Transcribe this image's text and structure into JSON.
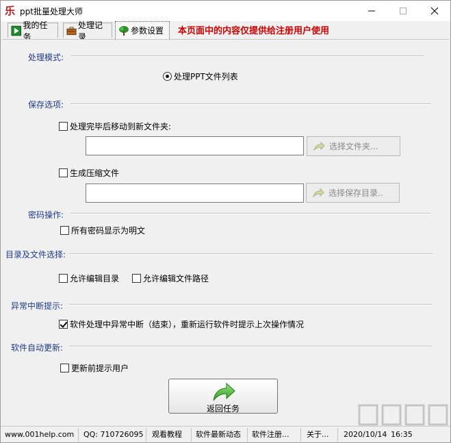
{
  "window": {
    "title": "ppt批量处理大师",
    "icon": "le-logo-icon"
  },
  "tabs": [
    {
      "label": "我的任务",
      "icon": "play-icon",
      "active": false
    },
    {
      "label": "处理记录",
      "icon": "briefcase-icon",
      "active": false
    },
    {
      "label": "参数设置",
      "icon": "tree-icon",
      "active": true
    }
  ],
  "notice": "本页面中的内容仅提供给注册用户使用",
  "sections": {
    "mode": {
      "title": "处理模式:",
      "radio_label": "处理PPT文件列表",
      "radio_selected": true
    },
    "save": {
      "title": "保存选项:",
      "move_label": "处理完毕后移动到新文件夹:",
      "move_checked": false,
      "folder_value": "",
      "choose_folder_label": "选择文件夹...",
      "zip_label": "生成压缩文件",
      "zip_checked": false,
      "zip_value": "",
      "choose_dir_label": "选择保存目录.."
    },
    "password": {
      "title": "密码操作:",
      "plain_label": "所有密码显示为明文",
      "plain_checked": false
    },
    "directory": {
      "title": "目录及文件选择:",
      "edit_dir_label": "允许编辑目录",
      "edit_dir_checked": false,
      "edit_path_label": "允许编辑文件路径",
      "edit_path_checked": false
    },
    "interrupt": {
      "title": "异常中断提示:",
      "prompt_label": "软件处理中异常中断（结束），重新运行软件时提示上次操作情况",
      "prompt_checked": true
    },
    "update": {
      "title": "软件自动更新:",
      "notify_label": "更新前提示用户",
      "notify_checked": false
    }
  },
  "return_button": {
    "label": "返回任务",
    "icon": "return-arrow-icon"
  },
  "statusbar": {
    "website": "www.001help.com",
    "qq": "QQ:  710726095",
    "tutorial": "观看教程",
    "news": "软件最新动态",
    "register": "软件注册...",
    "about": "关于...",
    "date": "2020/10/14",
    "time": "16:35"
  },
  "colors": {
    "notice": "#d00000",
    "section_title": "#1f3a8a",
    "panel_bg": "#f0f0f0"
  }
}
